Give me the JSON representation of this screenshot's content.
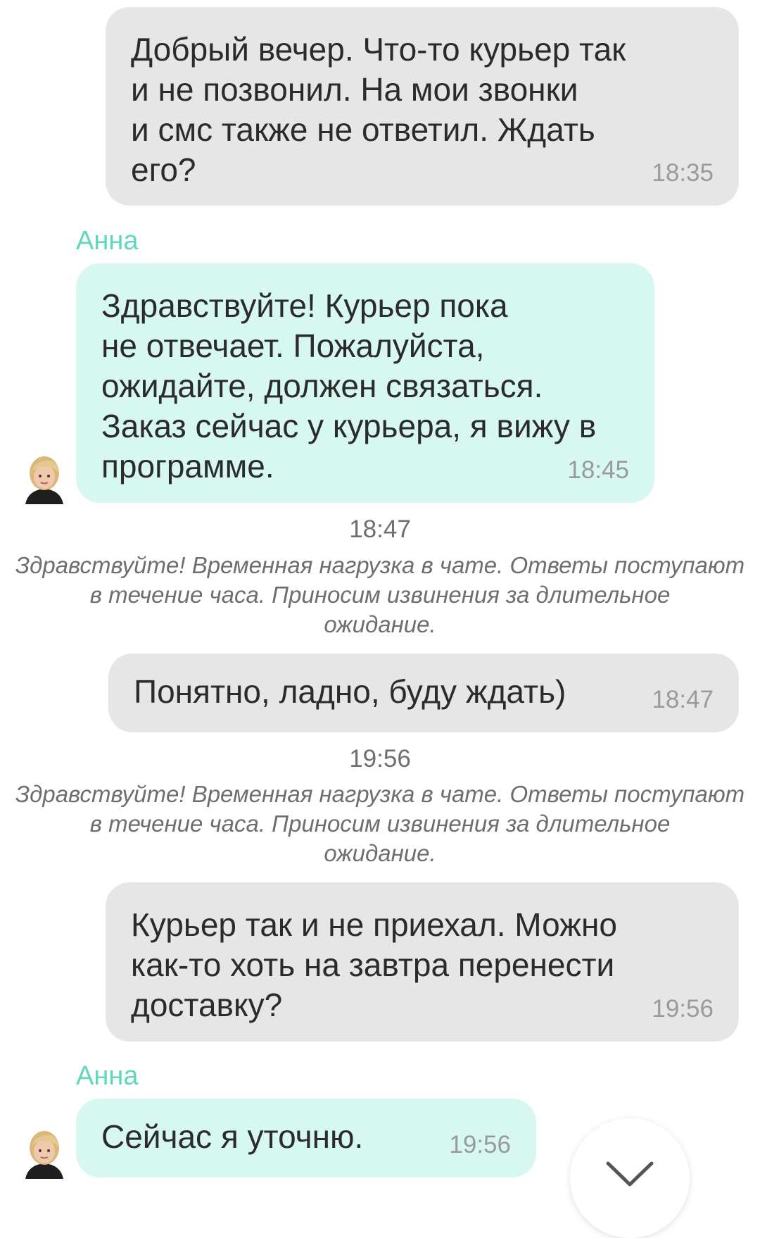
{
  "messages": [
    {
      "type": "outgoing",
      "text": "Добрый вечер. Что-то курьер так\nи не позвонил. На мои звонки\nи смс также не ответил. Ждать\nего?",
      "time": "18:35"
    },
    {
      "type": "incoming",
      "sender": "Анна",
      "text": "Здравствуйте! Курьер пока\nне отвечает. Пожалуйста,\nожидайте, должен связаться.\nЗаказ сейчас у курьера, я вижу в\nпрограмме.",
      "time": "18:45"
    },
    {
      "type": "system",
      "time": "18:47",
      "note": "Здравствуйте! Временная нагрузка в чате. Ответы поступают\nв течение часа. Приносим извинения за длительное\nожидание."
    },
    {
      "type": "outgoing",
      "text": "Понятно, ладно, буду ждать)",
      "time": "18:47"
    },
    {
      "type": "system",
      "time": "19:56",
      "note": "Здравствуйте! Временная нагрузка в чате. Ответы поступают\nв течение часа. Приносим извинения за длительное\nожидание."
    },
    {
      "type": "outgoing",
      "text": "Курьер так и не приехал. Можно\nкак-то хоть на завтра перенести\nдоставку?",
      "time": "19:56"
    },
    {
      "type": "incoming",
      "sender": "Анна",
      "text": "Сейчас я уточню.",
      "time": "19:56"
    }
  ],
  "icons": {
    "avatar": "operator-avatar",
    "scroll_down": "chevron-down-icon"
  },
  "colors": {
    "outgoing_bubble": "#e6e6e6",
    "incoming_bubble": "#d6f8f0",
    "sender_name": "#5fd8bd",
    "timestamp": "#9a9a9a"
  }
}
